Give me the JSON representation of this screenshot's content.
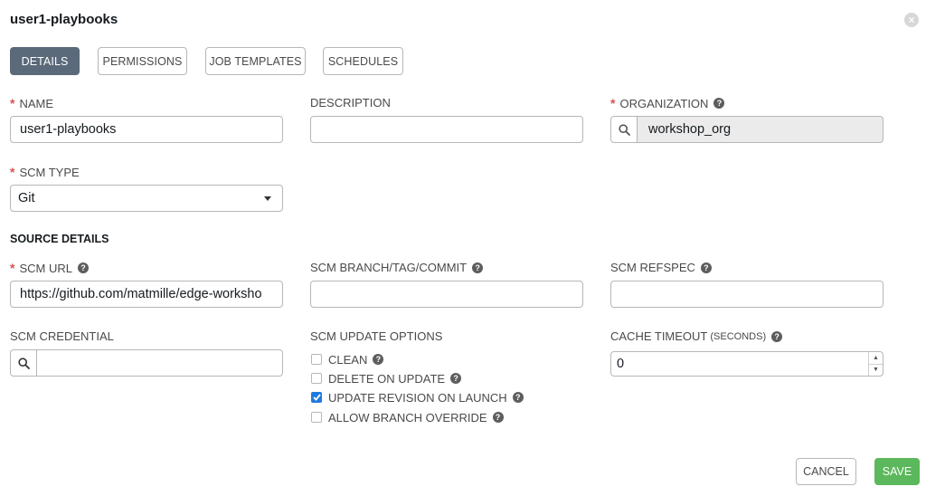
{
  "header": {
    "title": "user1-playbooks",
    "close_glyph": "×"
  },
  "tabs": [
    {
      "label": "DETAILS",
      "active": true
    },
    {
      "label": "PERMISSIONS",
      "active": false
    },
    {
      "label": "JOB TEMPLATES",
      "active": false
    },
    {
      "label": "SCHEDULES",
      "active": false
    }
  ],
  "form": {
    "name": {
      "label": "NAME",
      "required": true,
      "value": "user1-playbooks"
    },
    "description": {
      "label": "DESCRIPTION",
      "value": ""
    },
    "organization": {
      "label": "ORGANIZATION",
      "required": true,
      "value": "workshop_org",
      "help_icon": "question-circle-icon"
    },
    "scm_type": {
      "label": "SCM TYPE",
      "required": true,
      "value": "Git"
    },
    "source_details": {
      "heading": "SOURCE DETAILS"
    },
    "scm_url": {
      "label": "SCM URL",
      "required": true,
      "value": "https://github.com/matmille/edge-worksho"
    },
    "scm_branch": {
      "label": "SCM BRANCH/TAG/COMMIT",
      "value": ""
    },
    "scm_refspec": {
      "label": "SCM REFSPEC",
      "value": ""
    },
    "scm_credential": {
      "label": "SCM CREDENTIAL",
      "value": ""
    },
    "scm_update_options": {
      "label": "SCM UPDATE OPTIONS",
      "options": [
        {
          "label": "CLEAN",
          "checked": false
        },
        {
          "label": "DELETE ON UPDATE",
          "checked": false
        },
        {
          "label": "UPDATE REVISION ON LAUNCH",
          "checked": true
        },
        {
          "label": "ALLOW BRANCH OVERRIDE",
          "checked": false
        }
      ]
    },
    "cache_timeout": {
      "label": "CACHE TIMEOUT",
      "label_suffix": "(SECONDS)",
      "value": "0"
    }
  },
  "actions": {
    "cancel": "CANCEL",
    "save": "SAVE"
  },
  "colors": {
    "active_tab": "#5b6a7a",
    "save": "#5cb85c",
    "required": "#d9534f",
    "checkbox_checked": "#1f7ae0"
  }
}
